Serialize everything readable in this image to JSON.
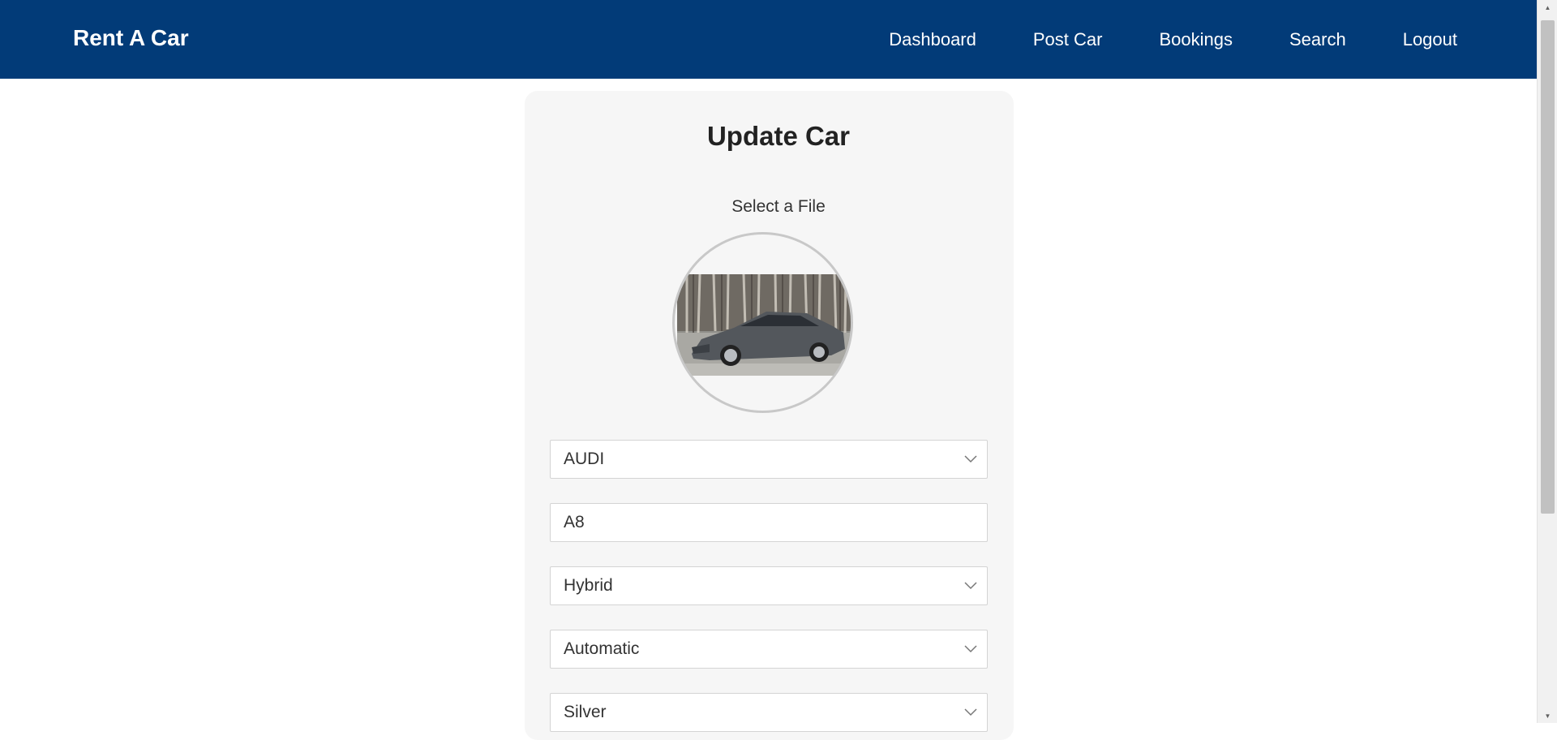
{
  "navbar": {
    "brand": "Rent A Car",
    "links": [
      "Dashboard",
      "Post Car",
      "Bookings",
      "Search",
      "Logout"
    ],
    "background": "#023b78"
  },
  "form": {
    "title": "Update Car",
    "select_file_label": "Select a File",
    "brand": {
      "value": "AUDI",
      "icon": "chevron-down-icon"
    },
    "model": {
      "value": "A8"
    },
    "fuel_type": {
      "value": "Hybrid",
      "icon": "chevron-down-icon"
    },
    "transmission": {
      "value": "Automatic",
      "icon": "chevron-down-icon"
    },
    "color": {
      "value": "Silver",
      "icon": "chevron-down-icon"
    }
  }
}
